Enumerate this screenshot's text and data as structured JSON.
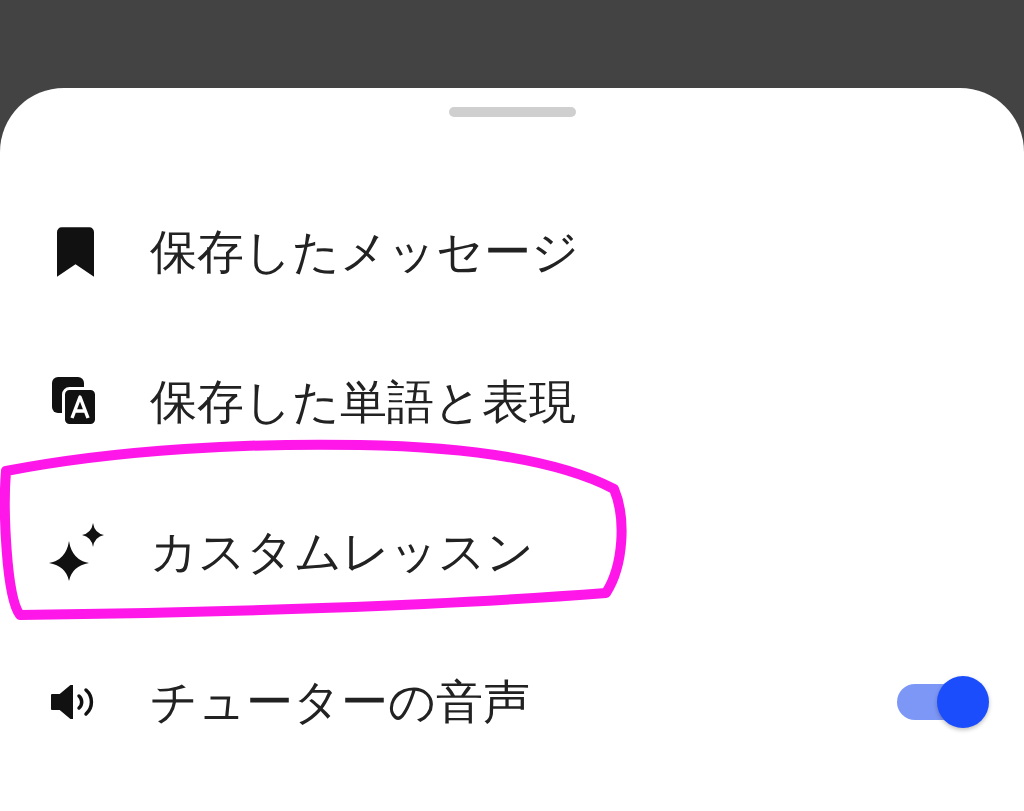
{
  "items": [
    {
      "kind": "link",
      "label": "保存したメッセージ",
      "circled": false
    },
    {
      "kind": "link",
      "label": "保存した単語と表現",
      "circled": false
    },
    {
      "kind": "link",
      "label": "カスタムレッスン",
      "circled": true
    },
    {
      "kind": "toggle",
      "label": "チューターの音声",
      "on": true,
      "circled": false
    }
  ]
}
